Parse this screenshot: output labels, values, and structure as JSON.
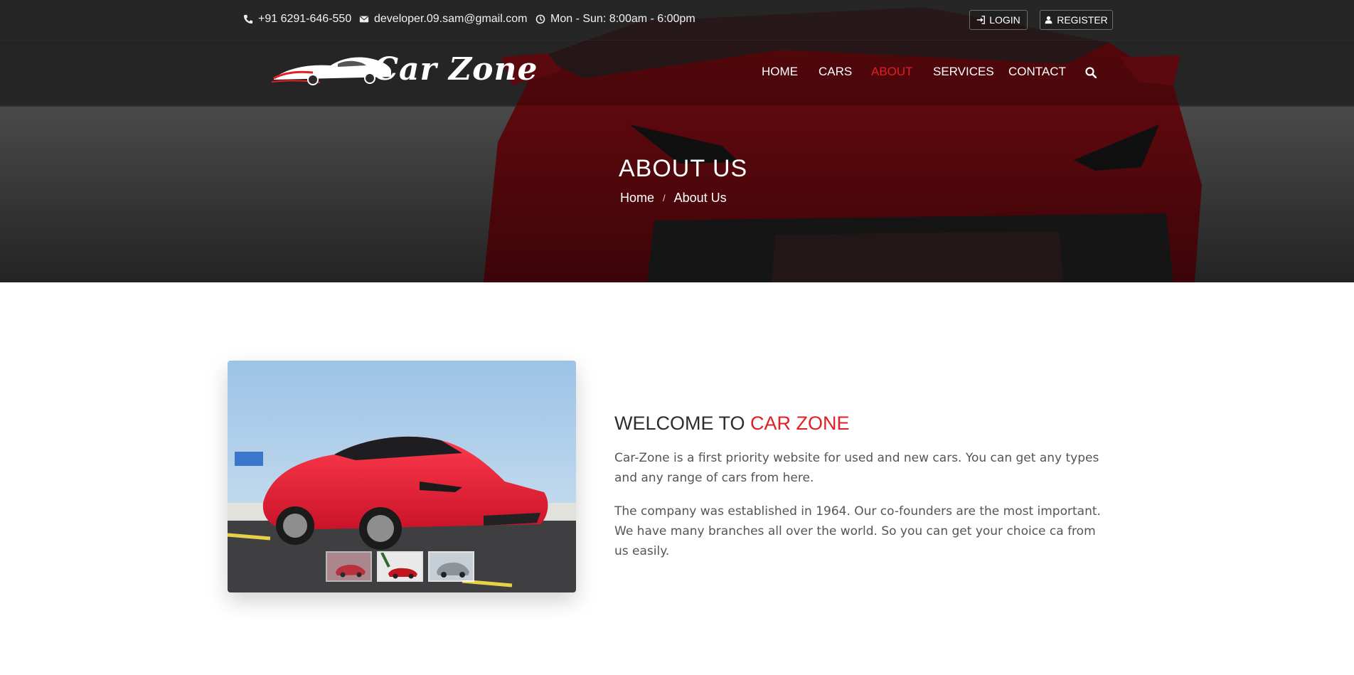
{
  "topbar": {
    "phone": "+91 6291-646-550",
    "email": "developer.09.sam@gmail.com",
    "hours": "Mon - Sun: 8:00am - 6:00pm",
    "login_label": "LOGIN",
    "register_label": "REGISTER"
  },
  "brand": {
    "logo_text": "Car Zone"
  },
  "nav": {
    "items": [
      "HOME",
      "CARS",
      "ABOUT",
      "SERVICES",
      "CONTACT"
    ],
    "active": "ABOUT"
  },
  "hero": {
    "title": "ABOUT US",
    "breadcrumb": [
      "Home",
      "About Us"
    ]
  },
  "about": {
    "heading_prefix": "WELCOME TO ",
    "heading_accent": "CAR ZONE",
    "paragraph_1": "Car-Zone is a first priority website for used and new cars. You can get any types and any range of cars from here.",
    "paragraph_2": "The company was established in 1964. Our co-founders are the most important. We have many branches all over the world. So you can get your choice ca from us easily."
  },
  "colors": {
    "accent": "#e31e24",
    "text": "#333333",
    "muted": "#555555"
  },
  "icons": {
    "phone": "phone-icon",
    "email": "envelope-icon",
    "hours": "clock-icon",
    "login": "sign-in-icon",
    "register": "user-icon",
    "search": "search-icon"
  }
}
